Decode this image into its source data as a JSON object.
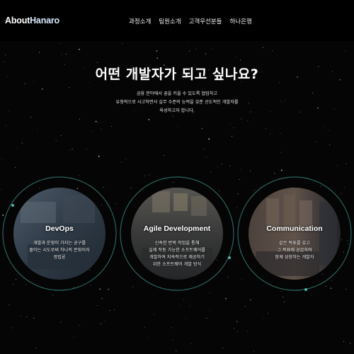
{
  "brand": {
    "part1": "About",
    "part2": "Hanaro"
  },
  "nav": {
    "items": [
      {
        "label": "과정소개"
      },
      {
        "label": "팀원소개"
      },
      {
        "label": "고객우선분들"
      },
      {
        "label": "하나은행"
      }
    ]
  },
  "hero": {
    "title": "어떤 개발자가 되고 싶나요?",
    "description": [
      "금융 분야에서 꿈을 키울 수 있도록 협업하고",
      "유형적으로 사고하면서 실무 수준의 능력을 갖춘 선도적인 개발자를",
      "육성하고자 합니다."
    ]
  },
  "cards": [
    {
      "title": "DevOps",
      "lines": [
        "개발과 운영이 가지는 공구를",
        "줄이는 시도로써 하나의 문화이자",
        "방법론"
      ]
    },
    {
      "title": "Agile Development",
      "lines": [
        "신속한 반복 작업을 통해",
        "실제 작동 가능한 소프트웨어를",
        "개발하여 지속적으로 제공하기",
        "위한 소프트웨어 개발 방식"
      ]
    },
    {
      "title": "Communication",
      "lines": [
        "같은 목표를 갖고",
        "그 목표에 공감하며",
        "함께 성장하는 개발자"
      ]
    }
  ],
  "colors": {
    "background": "#050505",
    "accent_ring": "#2f6f66",
    "nav_bg": "#000000"
  }
}
